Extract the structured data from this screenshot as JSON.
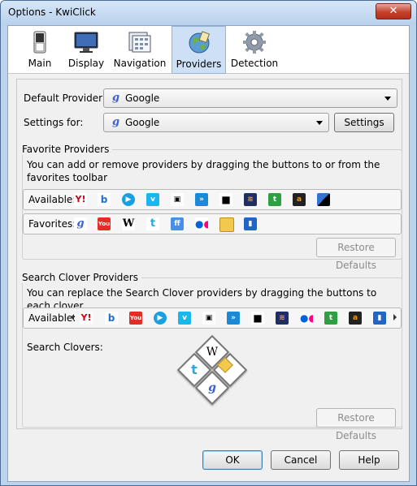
{
  "window": {
    "title": "Options - KwiClick",
    "close_label": "✕"
  },
  "tabs": [
    {
      "label": "Main"
    },
    {
      "label": "Display"
    },
    {
      "label": "Navigation"
    },
    {
      "label": "Providers"
    },
    {
      "label": "Detection"
    }
  ],
  "defaults": {
    "default_provider_label": "Default Provider:",
    "default_provider_value": "Google",
    "settings_for_label": "Settings for:",
    "settings_for_value": "Google",
    "settings_button": "Settings",
    "google_glyph": "g"
  },
  "favorites": {
    "title": "Favorite Providers",
    "description": "You can add or remove providers by dragging the buttons to or from the favorites toolbar",
    "available_label": "Available:",
    "favorites_label": "Favorites:",
    "restore_button": "Restore Defaults",
    "available_icons": [
      "yahoo-icon",
      "bing-icon",
      "play-icon",
      "vimeo-icon",
      "tv-icon",
      "arrow-icon",
      "camera-icon",
      "wifi-icon",
      "chat-icon",
      "amazon-icon",
      "delicious-icon"
    ],
    "favorites_icons": [
      "google-icon",
      "youtube-icon",
      "wikipedia-icon",
      "twitter-icon",
      "friendfeed-icon",
      "flickr-icon",
      "image-icon",
      "film-icon"
    ]
  },
  "clover": {
    "title": "Search Clover Providers",
    "description": "You can replace the Search Clover providers by dragging the buttons to each clover",
    "available_label": "Available:",
    "clovers_label": "Search Clovers:",
    "restore_button": "Restore Defaults",
    "available_icons": [
      "yahoo-icon",
      "bing-icon",
      "youtube-icon",
      "play-icon",
      "vimeo-icon",
      "tv-icon",
      "arrow-icon",
      "camera-icon",
      "wifi-icon",
      "flickr-icon",
      "chat-icon",
      "amazon-icon",
      "film-icon"
    ]
  },
  "footer": {
    "ok_button": "OK",
    "cancel_button": "Cancel",
    "help_button": "Help"
  }
}
